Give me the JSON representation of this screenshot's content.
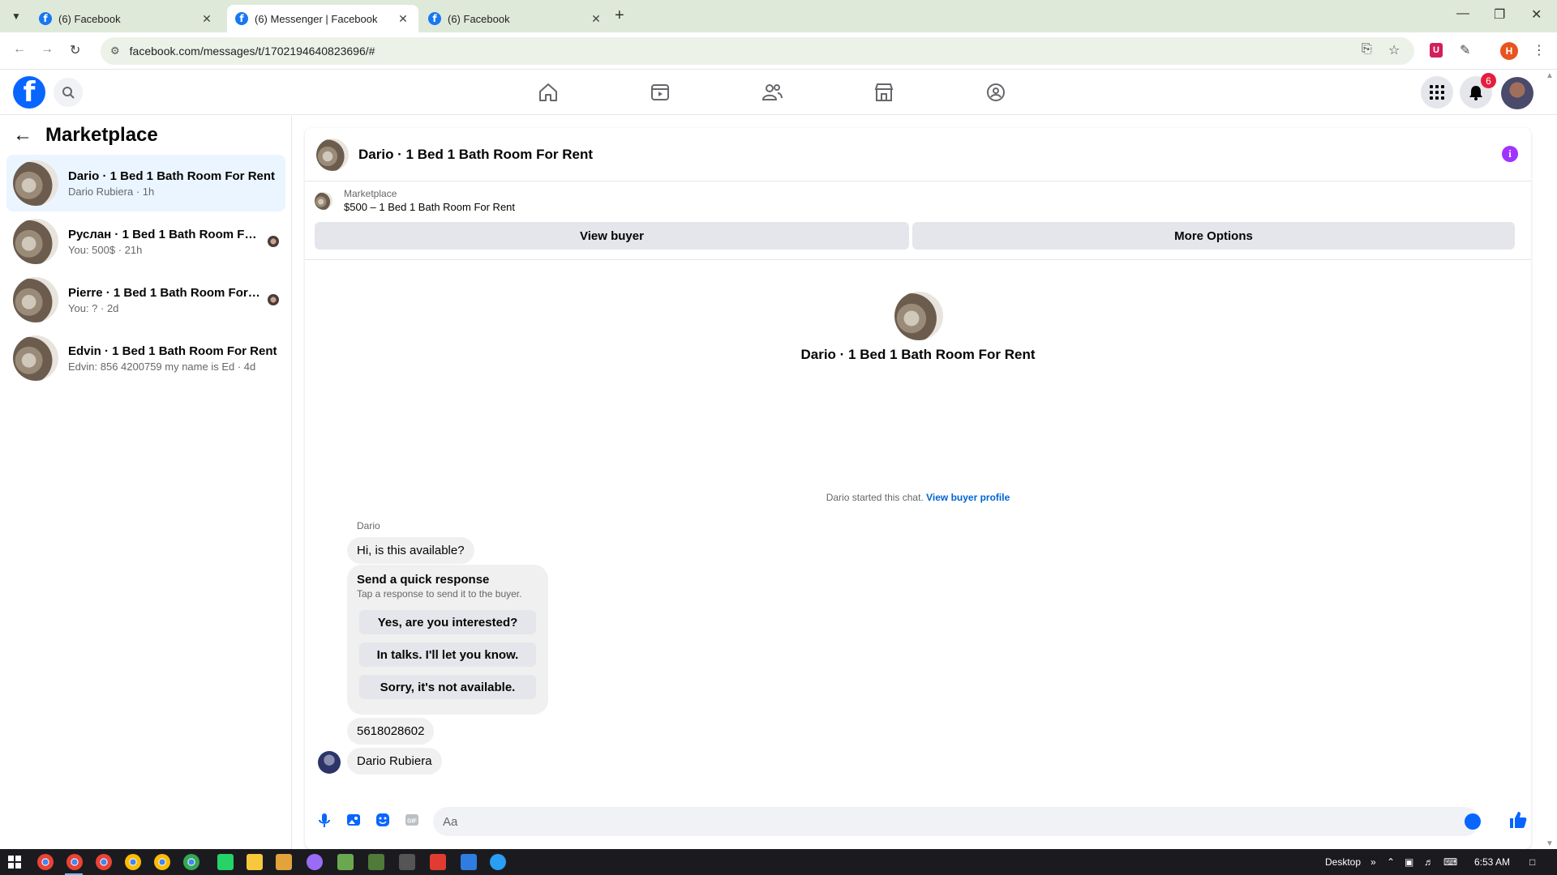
{
  "browser": {
    "tabs": [
      {
        "title": "(6) Facebook",
        "active": false
      },
      {
        "title": "(6) Messenger | Facebook",
        "active": true
      },
      {
        "title": "(6) Facebook",
        "active": false
      }
    ],
    "url": "facebook.com/messages/t/1702194640823696/#",
    "profile_initial": "H",
    "ext_label": "U"
  },
  "fbnav": {
    "logo": "f",
    "notification_count": "6",
    "nav_items": [
      "home-icon",
      "video-icon",
      "friends-icon",
      "marketplace-icon",
      "gaming-icon"
    ]
  },
  "sidebar": {
    "title": "Marketplace",
    "conversations": [
      {
        "title": "Dario · 1 Bed 1 Bath Room For Rent",
        "subtitle": "Dario Rubiera · 1h",
        "selected": true
      },
      {
        "title": "Руслан · 1 Bed 1 Bath Room For ...",
        "subtitle": "You: 500$ · 21h",
        "selected": false
      },
      {
        "title": "Pierre · 1 Bed 1 Bath Room For R...",
        "subtitle": "You: ? · 2d",
        "selected": false
      },
      {
        "title": "Edvin · 1 Bed 1 Bath Room For Rent",
        "subtitle": "Edvin: 856 4200759 my name is Ed · 4d",
        "selected": false
      }
    ]
  },
  "chat": {
    "header_title": "Dario · 1 Bed 1 Bath Room For Rent",
    "listing_source": "Marketplace",
    "listing_title": "$500 – 1 Bed 1 Bath Room For Rent",
    "view_buyer_label": "View buyer",
    "more_options_label": "More Options",
    "intro_title": "Dario · 1 Bed 1 Bath Room For Rent",
    "started_text": "Dario started this chat. ",
    "view_buyer_profile_label": "View buyer profile",
    "sender_name": "Dario",
    "messages": [
      "Hi, is this available?",
      "5618028602",
      "Dario Rubiera"
    ],
    "quick_response": {
      "title": "Send a quick response",
      "subtitle": "Tap a response to send it to the buyer.",
      "options": [
        "Yes, are you interested?",
        "In talks. I'll let you know.",
        "Sorry, it's not available."
      ]
    },
    "composer_placeholder": "Aa"
  },
  "taskbar": {
    "desktop_label": "Desktop",
    "time": "6:53 AM"
  }
}
